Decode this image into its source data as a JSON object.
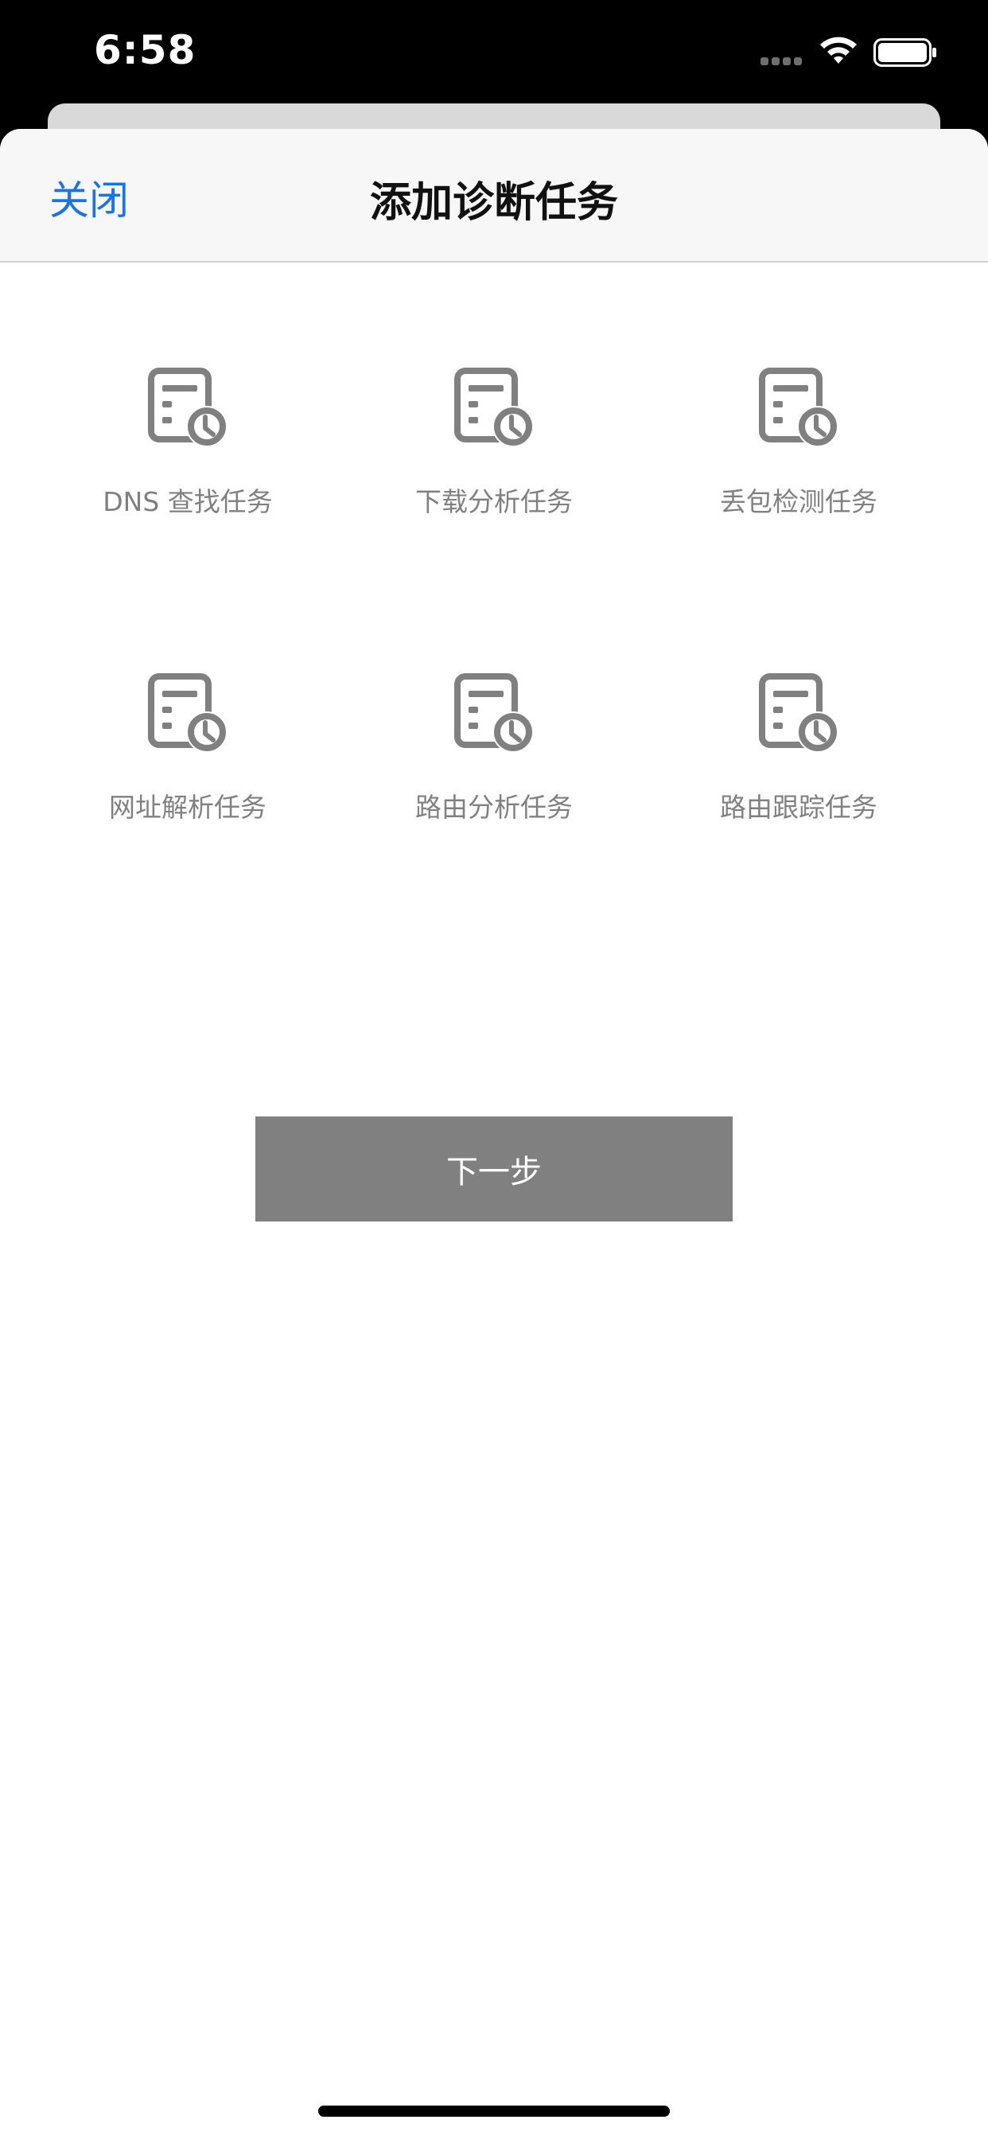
{
  "status_bar": {
    "time": "6:58"
  },
  "nav": {
    "close_label": "关闭",
    "title": "添加诊断任务"
  },
  "tasks": [
    {
      "label": "DNS 查找任务",
      "icon": "document-clock-icon"
    },
    {
      "label": "下载分析任务",
      "icon": "document-clock-icon"
    },
    {
      "label": "丢包检测任务",
      "icon": "document-clock-icon"
    },
    {
      "label": "网址解析任务",
      "icon": "document-clock-icon"
    },
    {
      "label": "路由分析任务",
      "icon": "document-clock-icon"
    },
    {
      "label": "路由跟踪任务",
      "icon": "document-clock-icon"
    }
  ],
  "next_button": {
    "label": "下一步"
  },
  "colors": {
    "accent": "#1a73e8",
    "icon_gray": "#808080",
    "button_gray": "#808080"
  }
}
